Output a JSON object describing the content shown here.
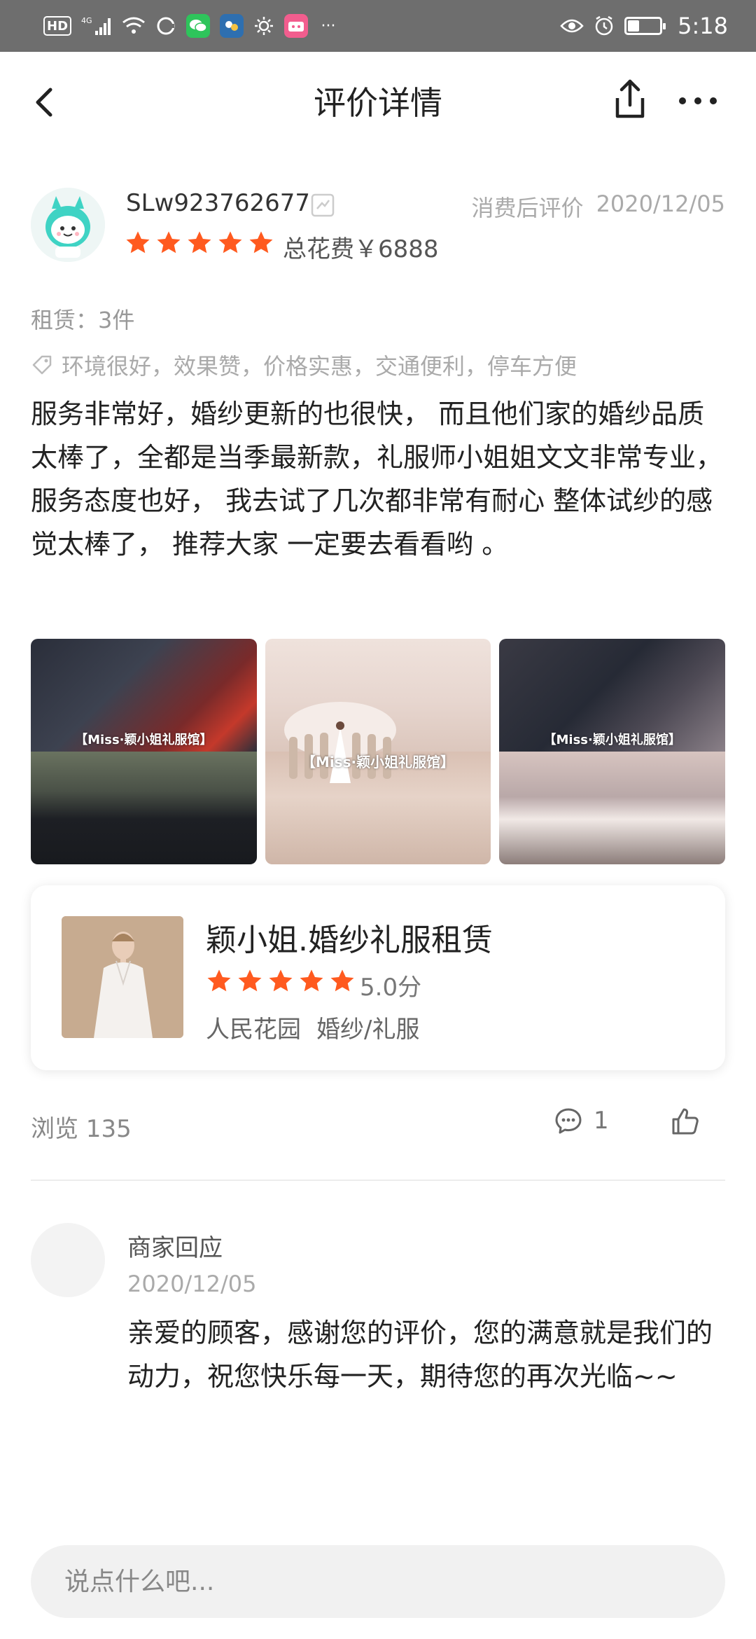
{
  "status_bar": {
    "network": "HD",
    "signal": "4G",
    "time": "5:18",
    "battery_level": 0.35,
    "overflow": "···"
  },
  "nav": {
    "title": "评价详情"
  },
  "review": {
    "user_name": "SLw923762677",
    "review_type": "消费后评价",
    "date": "2020/12/05",
    "rating": 5,
    "total_cost": "总花费￥6888",
    "rental": "租赁：3件",
    "tags": "环境很好，效果赞，价格实惠，交通便利，停车方便",
    "text": "服务非常好，婚纱更新的也很快， 而且他们家的婚纱品质太棒了，全都是当季最新款，礼服师小姐姐文文非常专业，服务态度也好， 我去试了几次都非常有耐心 整体试纱的感觉太棒了， 推荐大家 一定要去看看哟 。",
    "photos": [
      {
        "watermark": "【Miss·颖小姐礼服馆】"
      },
      {
        "watermark": "【Miss·颖小姐礼服馆】"
      },
      {
        "watermark": "【Miss·颖小姐礼服馆】"
      }
    ]
  },
  "shop": {
    "name": "颖小姐.婚纱礼服租赁",
    "rating": 5,
    "score": "5.0分",
    "area": "人民花园",
    "category": "婚纱/礼服"
  },
  "stats": {
    "views": "浏览 135",
    "comments": "1"
  },
  "merchant_reply": {
    "label": "商家回应",
    "date": "2020/12/05",
    "text": "亲爱的顾客，感谢您的评价，您的满意就是我们的动力，祝您快乐每一天，期待您的再次光临~~"
  },
  "input": {
    "placeholder": "说点什么吧..."
  },
  "colors": {
    "star": "#ff5a1f",
    "status_bar": "#6e6e6e"
  }
}
